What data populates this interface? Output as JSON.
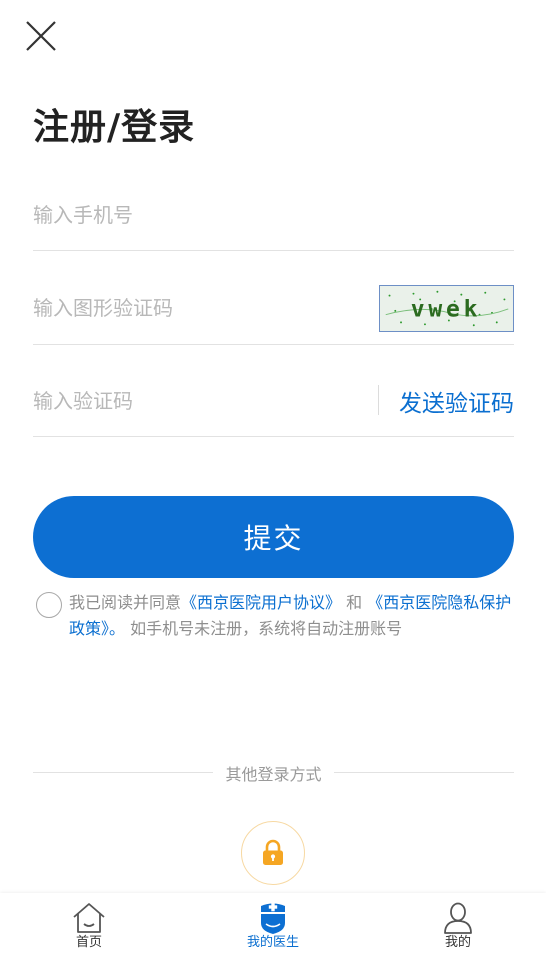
{
  "header": {
    "close_icon": "close-icon",
    "title": "注册/登录"
  },
  "form": {
    "phone_placeholder": "输入手机号",
    "captcha_placeholder": "输入图形验证码",
    "captcha_image_text": "vwek",
    "code_placeholder": "输入验证码",
    "send_code_label": "发送验证码",
    "submit_label": "提交"
  },
  "agreement": {
    "checked": false,
    "prefix": "我已阅读并同意",
    "user_agreement": "《西京医院用户协议》",
    "and": " 和 ",
    "privacy_policy": "《西京医院隐私保护政策》。",
    "suffix": " 如手机号未注册，系统将自动注册账号"
  },
  "other_login": {
    "label": "其他登录方式",
    "icon": "lock-icon",
    "icon_color": "#f5a623"
  },
  "bottom_nav": {
    "items": [
      {
        "label": "首页",
        "icon": "home-icon",
        "active": false
      },
      {
        "label": "我的医生",
        "icon": "doctor-icon",
        "active": true
      },
      {
        "label": "我的",
        "icon": "user-icon",
        "active": false
      }
    ]
  },
  "colors": {
    "accent": "#0d6fd2",
    "link": "#0b6fd0",
    "placeholder": "#b8b8b8"
  }
}
